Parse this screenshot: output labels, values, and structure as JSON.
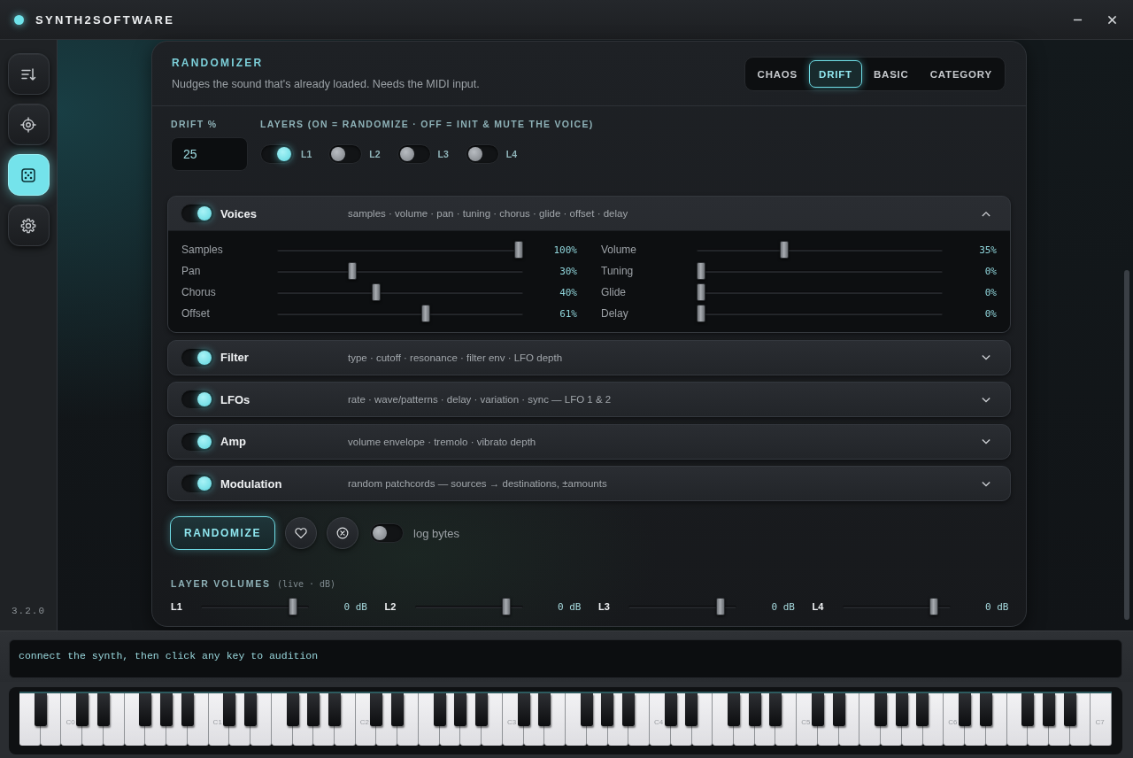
{
  "window": {
    "title": "SYNTH2SOFTWARE"
  },
  "sidebar": {
    "items": [
      {
        "kind": "sort",
        "selected": false
      },
      {
        "kind": "target",
        "selected": false
      },
      {
        "kind": "dice",
        "selected": true
      },
      {
        "kind": "settings",
        "selected": false
      }
    ],
    "version": "3.2.0"
  },
  "randomizer": {
    "title": "RANDOMIZER",
    "subtitle": "Nudges the sound that's already loaded. Needs the MIDI input.",
    "tabs": [
      {
        "label": "CHAOS",
        "selected": false
      },
      {
        "label": "DRIFT",
        "selected": true
      },
      {
        "label": "BASIC",
        "selected": false
      },
      {
        "label": "CATEGORY",
        "selected": false
      }
    ]
  },
  "drift": {
    "label": "DRIFT %",
    "value": "25"
  },
  "layers": {
    "label": "LAYERS (ON = RANDOMIZE · OFF = INIT & MUTE THE VOICE)",
    "items": [
      {
        "label": "L1",
        "on": true
      },
      {
        "label": "L2",
        "on": false
      },
      {
        "label": "L3",
        "on": false
      },
      {
        "label": "L4",
        "on": false
      }
    ]
  },
  "sections": [
    {
      "name": "Voices",
      "on": true,
      "description": "samples · volume · pan · tuning · chorus · glide · offset · delay",
      "expanded": true,
      "params": [
        {
          "name": "Samples",
          "level": 1,
          "reading": "100%"
        },
        {
          "name": "Volume",
          "level": 0.35,
          "reading": "35%"
        },
        {
          "name": "Pan",
          "level": 0.3,
          "reading": "30%"
        },
        {
          "name": "Tuning",
          "level": 0,
          "reading": "0%"
        },
        {
          "name": "Chorus",
          "level": 0.4,
          "reading": "40%"
        },
        {
          "name": "Glide",
          "level": 0,
          "reading": "0%"
        },
        {
          "name": "Offset",
          "level": 0.61,
          "reading": "61%"
        },
        {
          "name": "Delay",
          "level": 0,
          "reading": "0%"
        }
      ]
    },
    {
      "name": "Filter",
      "on": true,
      "description": "type · cutoff · resonance · filter env · LFO depth",
      "expanded": false
    },
    {
      "name": "LFOs",
      "on": true,
      "description": "rate · wave/patterns · delay · variation · sync — LFO 1 & 2",
      "expanded": false
    },
    {
      "name": "Amp",
      "on": true,
      "description": "volume envelope · tremolo · vibrato depth",
      "expanded": false
    },
    {
      "name": "Modulation",
      "on": true,
      "description": "random patchcords — sources → destinations, ±amounts",
      "expanded": false
    }
  ],
  "actions": {
    "randomize_button": "RANDOMIZE",
    "log_bytes": {
      "label": "log bytes",
      "on": false
    }
  },
  "layer_volumes": {
    "title": "LAYER VOLUMES",
    "note": "(live · dB)",
    "layers": [
      {
        "label": "L1",
        "level": 0.88,
        "reading": "0 dB"
      },
      {
        "label": "L2",
        "level": 0.88,
        "reading": "0 dB"
      },
      {
        "label": "L3",
        "level": 0.88,
        "reading": "0 dB"
      },
      {
        "label": "L4",
        "level": 0.88,
        "reading": "0 dB"
      }
    ]
  },
  "status_bar": {
    "message": "connect the synth, then click any key to audition"
  },
  "keyboard": {
    "octave_labels": [
      "C0",
      "C1",
      "C2",
      "C3",
      "C4",
      "C5",
      "C6",
      "C7"
    ]
  }
}
